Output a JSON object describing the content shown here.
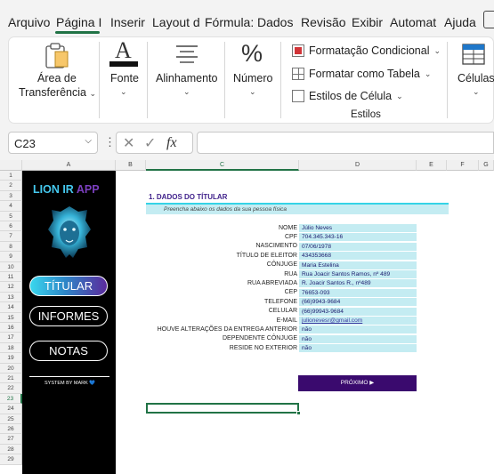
{
  "tabs": [
    "Arquivo",
    "Página I",
    "Inserir",
    "Layout d",
    "Fórmula:",
    "Dados",
    "Revisão",
    "Exibir",
    "Automat",
    "Ajuda"
  ],
  "ribbon": {
    "clipboard_line1": "Área de",
    "clipboard_line2": "Transferência",
    "font_label": "Fonte",
    "align_label": "Alinhamento",
    "number_symbol": "%",
    "number_label": "Número",
    "cond_format": "Formatação Condicional",
    "format_table": "Formatar como Tabela",
    "cell_styles": "Estilos de Célula",
    "styles_group": "Estilos",
    "cells_label": "Células"
  },
  "formula_bar": {
    "name_box": "C23",
    "fx": "fx",
    "value": ""
  },
  "columns": [
    "A",
    "B",
    "C",
    "D",
    "E",
    "F",
    "G"
  ],
  "rows": [
    "1",
    "2",
    "3",
    "4",
    "5",
    "6",
    "7",
    "8",
    "9",
    "10",
    "11",
    "12",
    "13",
    "14",
    "15",
    "16",
    "17",
    "18",
    "19",
    "20",
    "21",
    "22",
    "23",
    "24",
    "25",
    "26",
    "27",
    "28",
    "29"
  ],
  "sidebar": {
    "logo_a": "LION IR ",
    "logo_b": "APP",
    "nav": [
      "TÍTULAR",
      "INFORMES",
      "NOTAS"
    ],
    "system": "SYSTEM BY MARK 💙"
  },
  "form": {
    "title": "1. DADOS DO TÍTULAR",
    "subtitle": "Preencha abaixo os dados da sua pessoa física",
    "fields": [
      {
        "label": "NOME",
        "value": "Júlio Neves"
      },
      {
        "label": "CPF",
        "value": "704.345.343-16"
      },
      {
        "label": "NASCIMENTO",
        "value": "07/06/1978"
      },
      {
        "label": "TÍTULO DE ELEITOR",
        "value": "434353668"
      },
      {
        "label": "CÔNJUGE",
        "value": "Maria Estelina"
      },
      {
        "label": "RUA",
        "value": "Rua Joacir Santos Ramos, nº 489"
      },
      {
        "label": "RUA ABREVIADA",
        "value": "R. Joacir Santos R., nº489"
      },
      {
        "label": "CEP",
        "value": "76653-093"
      },
      {
        "label": "TELEFONE",
        "value": "(66)9943-9684"
      },
      {
        "label": "CELULAR",
        "value": "(66)99943-9684"
      },
      {
        "label": "E-MAIL",
        "value": "julionevesr@gmail.com"
      },
      {
        "label": "HOUVE ALTERAÇÕES DA ENTREGA ANTERIOR",
        "value": "não"
      },
      {
        "label": "DEPENDENTE CÔNJUGE",
        "value": "não"
      },
      {
        "label": "RESIDE NO EXTERIOR",
        "value": "não"
      }
    ],
    "next_button": "PRÓXIMO ▶"
  }
}
